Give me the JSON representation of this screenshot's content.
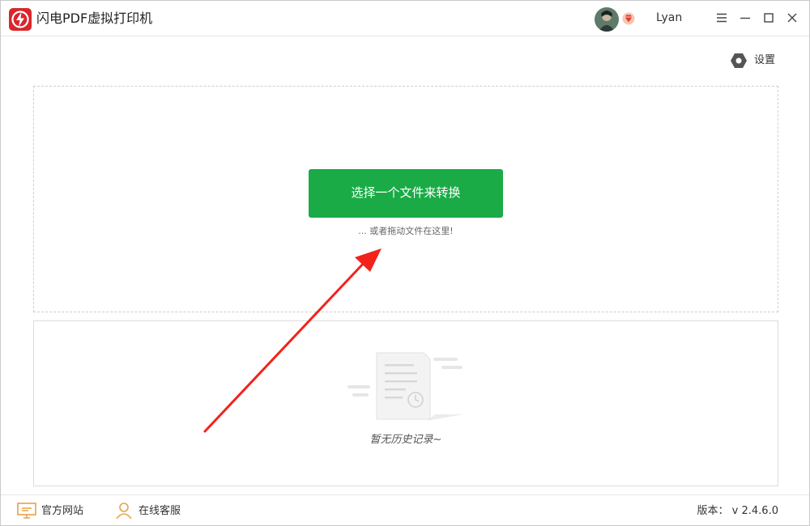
{
  "app": {
    "title": "闪电PDF虚拟打印机",
    "brand_color": "#d9262c",
    "accent_color": "#1aab47"
  },
  "user": {
    "name": "Lyan",
    "avatar_icon": "avatar-icon",
    "vip_icon": "vip-diamond-icon"
  },
  "window_controls": {
    "menu_icon": "menu-icon",
    "minimize_icon": "minimize-icon",
    "maximize_icon": "maximize-icon",
    "close_icon": "close-icon"
  },
  "settings": {
    "label": "设置",
    "icon": "gear-icon"
  },
  "dropzone": {
    "button_label": "选择一个文件来转换",
    "hint": "... 或者拖动文件在这里!"
  },
  "history": {
    "empty_text": "暂无历史记录~",
    "icon": "empty-history-icon"
  },
  "footer": {
    "website_label": "官方网站",
    "website_icon": "monitor-icon",
    "support_label": "在线客服",
    "support_icon": "support-user-icon",
    "version": "版本： v 2.4.6.0"
  }
}
